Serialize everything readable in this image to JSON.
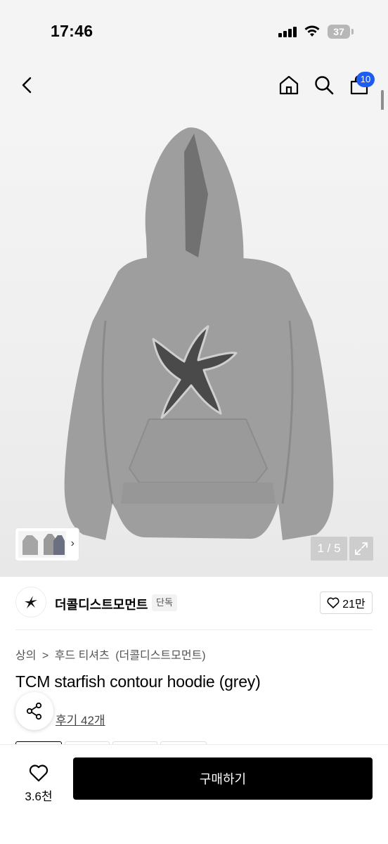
{
  "status_bar": {
    "time": "17:46",
    "battery": "37"
  },
  "nav": {
    "cart_count": "10",
    "icons": [
      "back-chevron-icon",
      "home-icon",
      "search-icon",
      "cart-icon"
    ]
  },
  "gallery": {
    "counter": "1 / 5",
    "product_color": "#9e9e9e",
    "patch_color": "#4a4a4a"
  },
  "brand": {
    "name": "더콜디스트모먼트",
    "tag": "단독",
    "likes": "21만"
  },
  "breadcrumb": {
    "category": "상의",
    "separator": ">",
    "subcategory": "후드 티셔츠",
    "brand_paren": "(더콜디스트모먼트)"
  },
  "product": {
    "title": "TCM starfish contour hoodie (grey)",
    "reviews": "후기 42개"
  },
  "bottom_bar": {
    "wish_count": "3.6천",
    "buy_label": "구매하기",
    "buy_color": "#000000"
  }
}
